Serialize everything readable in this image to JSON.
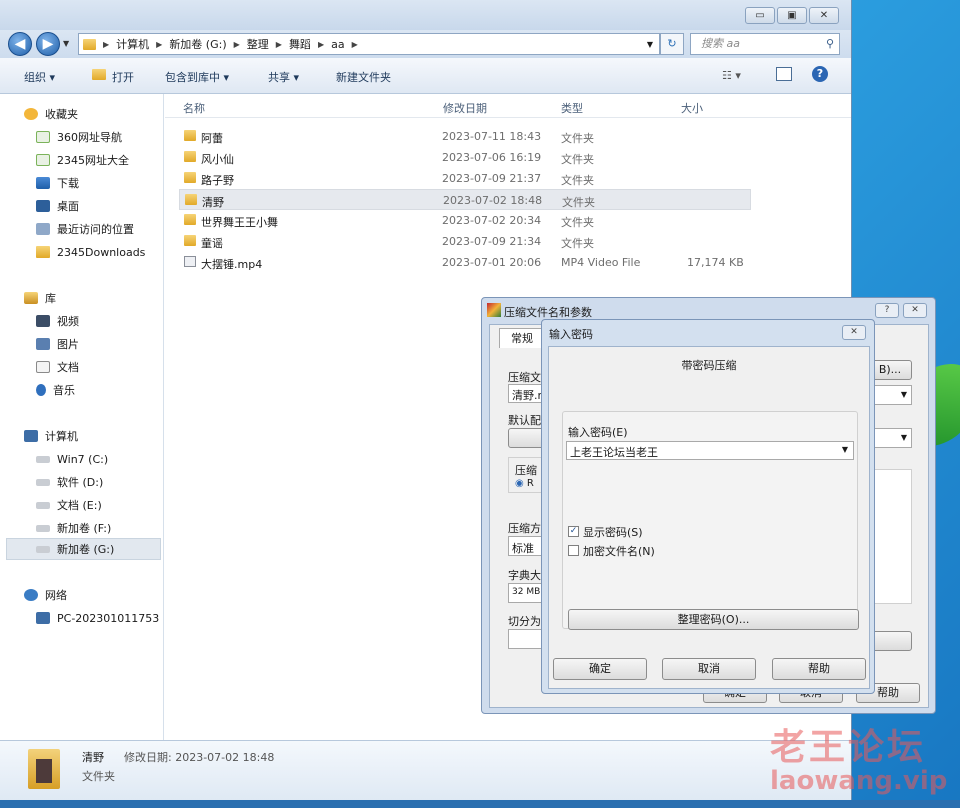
{
  "window": {
    "minimize": "▭",
    "maximize": "▣",
    "close": "✕"
  },
  "address": {
    "crumbs": [
      "计算机",
      "新加卷 (G:)",
      "整理",
      "舞蹈",
      "aa"
    ],
    "search_placeholder": "搜索 aa"
  },
  "toolbar": {
    "organize": "组织 ▾",
    "open": "打开",
    "include": "包含到库中 ▾",
    "share": "共享 ▾",
    "new_folder": "新建文件夹"
  },
  "nav": {
    "favorites": {
      "title": "收藏夹",
      "items": [
        "360网址导航",
        "2345网址大全",
        "下载",
        "桌面",
        "最近访问的位置",
        "2345Downloads"
      ]
    },
    "libraries": {
      "title": "库",
      "items": [
        "视频",
        "图片",
        "文档",
        "音乐"
      ]
    },
    "computer": {
      "title": "计算机",
      "items": [
        "Win7 (C:)",
        "软件 (D:)",
        "文档 (E:)",
        "新加卷 (F:)",
        "新加卷 (G:)"
      ]
    },
    "network": {
      "title": "网络",
      "items": [
        "PC-202301011753"
      ]
    }
  },
  "columns": {
    "name": "名称",
    "date": "修改日期",
    "type": "类型",
    "size": "大小"
  },
  "files": [
    {
      "name": "阿蕾",
      "date": "2023-07-11 18:43",
      "type": "文件夹",
      "size": ""
    },
    {
      "name": "风小仙",
      "date": "2023-07-06 16:19",
      "type": "文件夹",
      "size": ""
    },
    {
      "name": "路子野",
      "date": "2023-07-09 21:37",
      "type": "文件夹",
      "size": ""
    },
    {
      "name": "清野",
      "date": "2023-07-02 18:48",
      "type": "文件夹",
      "size": ""
    },
    {
      "name": "世界舞王王小舞",
      "date": "2023-07-02 20:34",
      "type": "文件夹",
      "size": ""
    },
    {
      "name": "童谣",
      "date": "2023-07-09 21:34",
      "type": "文件夹",
      "size": ""
    },
    {
      "name": "大摆锤.mp4",
      "date": "2023-07-01 20:06",
      "type": "MP4 Video File",
      "size": "17,174 KB"
    }
  ],
  "details": {
    "name": "清野",
    "date_label": "修改日期: 2023-07-02 18:48",
    "type": "文件夹"
  },
  "archive_dialog": {
    "title": "压缩文件名和参数",
    "help": "?",
    "close": "✕",
    "tab_general": "常规",
    "label_archive": "压缩文",
    "archive_value": "清野.r",
    "browse_fragment": "B)...",
    "label_default": "默认配",
    "group_format": "压缩",
    "radio_fragment": "R",
    "label_method": "压缩方",
    "method_value": "标准",
    "label_dict": "字典大",
    "dict_value": "32 MB",
    "label_split": "切分为",
    "ok": "确定",
    "cancel": "取消",
    "help_button": "帮助"
  },
  "password_dialog": {
    "title": "输入密码",
    "close": "✕",
    "heading": "带密码压缩",
    "password_label": "输入密码(E)",
    "password_value": "上老王论坛当老王",
    "show_password": "显示密码(S)",
    "encrypt_names": "加密文件名(N)",
    "organize": "整理密码(O)...",
    "ok": "确定",
    "cancel": "取消",
    "help": "帮助"
  },
  "watermark": {
    "brand": "老王论坛",
    "domain": "laowang.vip"
  },
  "colors": {
    "accent": "#1f5fa9",
    "folder": "#e1a928",
    "watermark": "#e85a5a"
  }
}
